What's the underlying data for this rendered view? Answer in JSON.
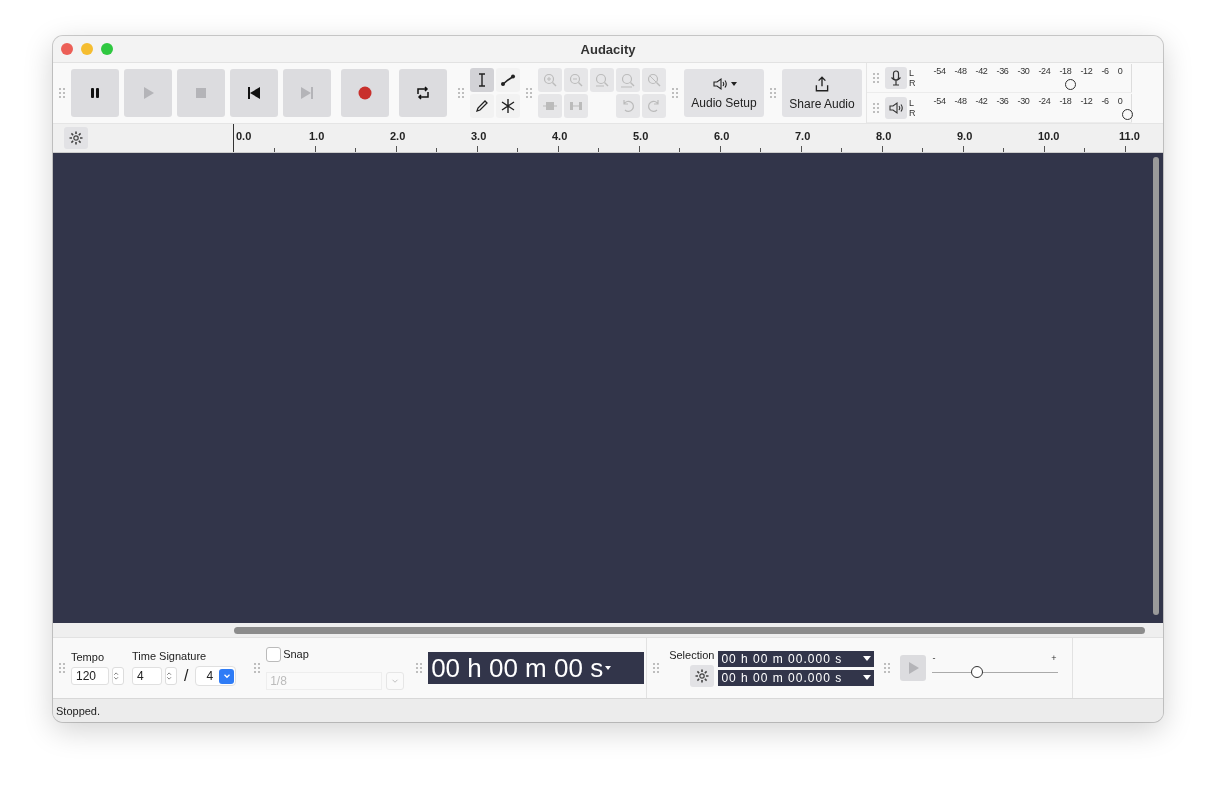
{
  "window": {
    "title": "Audacity"
  },
  "transport": [
    {
      "kind": "pause",
      "disabled": false
    },
    {
      "kind": "play",
      "disabled": true
    },
    {
      "kind": "stop",
      "disabled": true
    },
    {
      "kind": "skip-start",
      "disabled": false
    },
    {
      "kind": "skip-end",
      "disabled": true
    },
    {
      "kind": "record",
      "disabled": false
    },
    {
      "kind": "loop",
      "disabled": false
    }
  ],
  "tools": [
    {
      "kind": "select",
      "selected": true
    },
    {
      "kind": "envelope",
      "selected": false
    },
    {
      "kind": "draw",
      "selected": false
    },
    {
      "kind": "multi",
      "selected": false
    }
  ],
  "edit_tools": [
    {
      "kind": "zoom-in",
      "disabled": true
    },
    {
      "kind": "zoom-out",
      "disabled": true
    },
    {
      "kind": "fit-selection",
      "disabled": true
    },
    {
      "kind": "fit-project",
      "disabled": true
    },
    {
      "kind": "zoom-toggle",
      "disabled": true
    },
    {
      "kind": "trim",
      "disabled": true
    },
    {
      "kind": "silence",
      "disabled": true
    },
    {
      "kind": "undo",
      "disabled": true
    },
    {
      "kind": "redo",
      "disabled": true
    }
  ],
  "audio_setup": {
    "label": "Audio Setup"
  },
  "share_audio": {
    "label": "Share Audio"
  },
  "meters": [
    {
      "kind": "record",
      "channels": [
        "L",
        "R"
      ],
      "ticks": [
        "-54",
        "-48",
        "-42",
        "-36",
        "-30",
        "-24",
        "-18",
        "-12",
        "-6",
        "0"
      ],
      "level": 0.72
    },
    {
      "kind": "playback",
      "channels": [
        "L",
        "R"
      ],
      "ticks": [
        "-54",
        "-48",
        "-42",
        "-36",
        "-30",
        "-24",
        "-18",
        "-12",
        "-6",
        "0"
      ],
      "level": 0.99
    }
  ],
  "ruler": {
    "labels": [
      "0.0",
      "1.0",
      "2.0",
      "3.0",
      "4.0",
      "5.0",
      "6.0",
      "7.0",
      "8.0",
      "9.0",
      "10.0",
      "11.0"
    ]
  },
  "time_signature_bar": {
    "tempo_label": "Tempo",
    "tempo": "120",
    "signature_label": "Time Signature",
    "beats": "4",
    "separator": "/",
    "note_value": "4"
  },
  "snap": {
    "label": "Snap",
    "checked": false,
    "value": "1/8",
    "disabled": true
  },
  "time_display": {
    "value": "00 h 00 m 00 s"
  },
  "selection": {
    "label": "Selection",
    "start": "00 h 00 m 00.000 s",
    "end": "00 h 00 m 00.000 s"
  },
  "play_at_speed": {
    "min_label": "-",
    "max_label": "+",
    "level": 0.35
  },
  "status_bar": {
    "text": "Stopped."
  }
}
